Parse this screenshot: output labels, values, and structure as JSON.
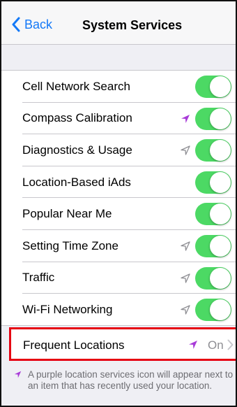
{
  "nav": {
    "back_label": "Back",
    "title": "System Services"
  },
  "rows": [
    {
      "label": "Cell Network Search",
      "enabled": true,
      "icon": "none"
    },
    {
      "label": "Compass Calibration",
      "enabled": true,
      "icon": "location-arrow-purple-icon"
    },
    {
      "label": "Diagnostics & Usage",
      "enabled": true,
      "icon": "location-arrow-gray-icon"
    },
    {
      "label": "Location-Based iAds",
      "enabled": true,
      "icon": "none"
    },
    {
      "label": "Popular Near Me",
      "enabled": true,
      "icon": "none"
    },
    {
      "label": "Setting Time Zone",
      "enabled": true,
      "icon": "location-arrow-gray-icon"
    },
    {
      "label": "Traffic",
      "enabled": true,
      "icon": "location-arrow-gray-icon"
    },
    {
      "label": "Wi-Fi Networking",
      "enabled": true,
      "icon": "location-arrow-gray-icon"
    }
  ],
  "frequent": {
    "label": "Frequent Locations",
    "value": "On",
    "icon": "location-arrow-purple-icon"
  },
  "footnote": "A purple location services icon will appear next to an item that has recently used your location.",
  "colors": {
    "accent_blue": "#1479f7",
    "toggle_green": "#4cd964",
    "location_purple": "#a83bd8",
    "location_gray": "#8e8e93",
    "highlight_red": "#e60012"
  }
}
